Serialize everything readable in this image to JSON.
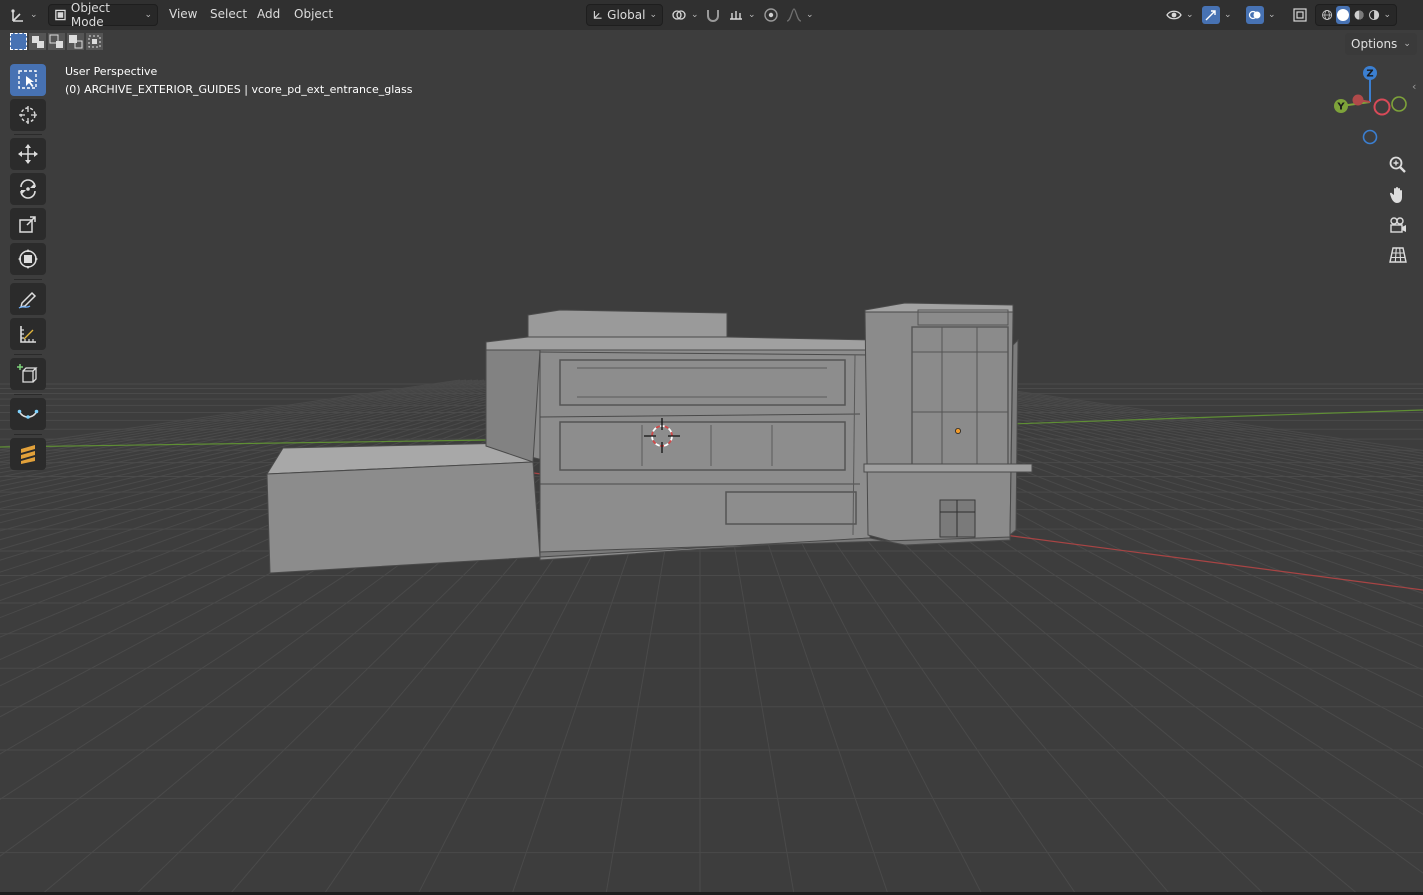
{
  "header": {
    "editor_type_icon": "axes-icon",
    "mode_label": "Object Mode",
    "menus": [
      "View",
      "Select",
      "Add",
      "Object"
    ],
    "transform_orientation": "Global"
  },
  "viewport": {
    "perspective_label": "User Perspective",
    "collection_label": "(0) ARCHIVE_EXTERIOR_GUIDES | vcore_pd_ext_entrance_glass",
    "options_label": "Options",
    "gizmo": {
      "z": "Z",
      "y": "Y"
    }
  },
  "toolbar": {
    "tools": [
      "select-box",
      "cursor",
      "move",
      "rotate",
      "scale",
      "transform",
      "annotate",
      "measure",
      "add-cube",
      "curve",
      "stripe"
    ],
    "active": "select-box"
  },
  "colors": {
    "header_bg": "#303030",
    "viewport_bg": "#3d3d3d",
    "active_tool": "#4772b3",
    "axis_x": "#b04a4a",
    "axis_y": "#6a9a3a",
    "axis_z": "#3b7fd1"
  }
}
